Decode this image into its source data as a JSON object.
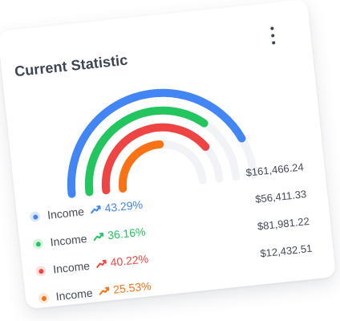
{
  "card": {
    "title": "Current Statistic",
    "menu_icon": "more-vertical-icon"
  },
  "chart_data": {
    "type": "radial-progress",
    "series": [
      {
        "label": "Income",
        "percent": 43.29,
        "color": "#4285f4"
      },
      {
        "label": "Income",
        "percent": 36.16,
        "color": "#22c55e"
      },
      {
        "label": "Income",
        "percent": 40.22,
        "color": "#ef4444"
      },
      {
        "label": "Income",
        "percent": 25.53,
        "color": "#f97316"
      }
    ],
    "track_color": "#f1f3f6"
  },
  "rows": [
    {
      "label": "Income",
      "percent": "43.29%",
      "amount": "$161,466.24",
      "color": "#4285f4",
      "light": "#dbe8fd",
      "trend_icon": "trending-up-icon"
    },
    {
      "label": "Income",
      "percent": "36.16%",
      "amount": "$56,411.33",
      "color": "#22c55e",
      "light": "#d5f5e0",
      "trend_icon": "trending-up-icon"
    },
    {
      "label": "Income",
      "percent": "40.22%",
      "amount": "$81,981.22",
      "color": "#ef4444",
      "light": "#fde0e0",
      "trend_icon": "trending-up-icon"
    },
    {
      "label": "Income",
      "percent": "25.53%",
      "amount": "$12,432.51",
      "color": "#f97316",
      "light": "#feead9",
      "trend_icon": "trending-up-icon"
    }
  ]
}
